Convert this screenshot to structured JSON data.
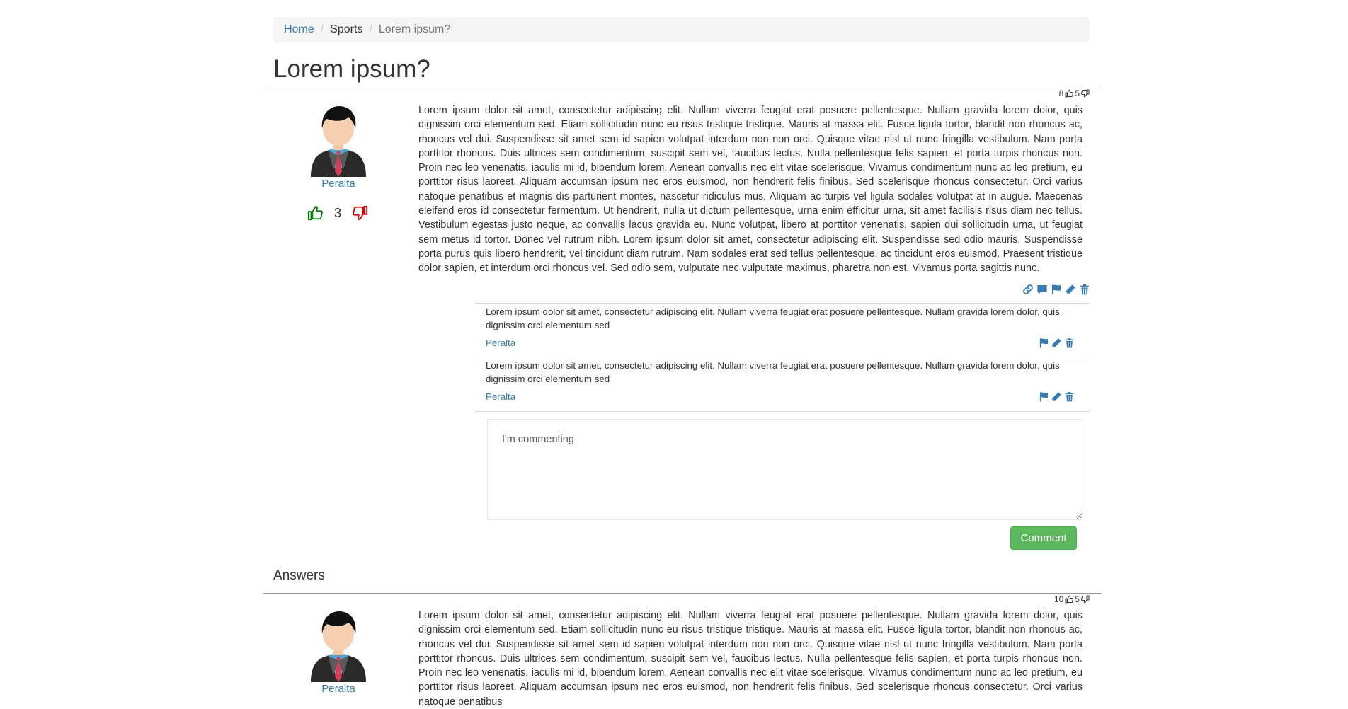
{
  "breadcrumb": {
    "home": "Home",
    "category": "Sports",
    "current": "Lorem ipsum?"
  },
  "question": {
    "title": "Lorem ipsum?",
    "upvotes": "8",
    "downvotes": "5",
    "author": "Peralta",
    "score": "3",
    "body": "Lorem ipsum dolor sit amet, consectetur adipiscing elit. Nullam viverra feugiat erat posuere pellentesque. Nullam gravida lorem dolor, quis dignissim orci elementum sed. Etiam sollicitudin nunc eu risus tristique tristique. Mauris at massa elit. Fusce ligula tortor, blandit non rhoncus ac, rhoncus vel dui. Suspendisse sit amet sem id sapien volutpat interdum non non orci. Quisque vitae nisl ut nunc fringilla vestibulum. Nam porta porttitor rhoncus. Duis ultrices sem condimentum, suscipit sem vel, faucibus lectus. Nulla pellentesque felis sapien, et porta turpis rhoncus non. Proin nec leo venenatis, iaculis mi id, bibendum lorem. Aenean convallis nec elit vitae scelerisque. Vivamus condimentum nunc ac leo pretium, eu porttitor risus laoreet. Aliquam accumsan ipsum nec eros euismod, non hendrerit felis finibus. Sed scelerisque rhoncus consectetur. Orci varius natoque penatibus et magnis dis parturient montes, nascetur ridiculus mus. Aliquam ac turpis vel ligula sodales volutpat at in augue. Maecenas eleifend eros id consectetur fermentum. Ut hendrerit, nulla ut dictum pellentesque, urna enim efficitur urna, sit amet facilisis risus diam nec tellus. Vestibulum egestas justo neque, ac convallis lacus gravida eu. Nunc volutpat, libero at porttitor venenatis, sapien dui sollicitudin urna, ut feugiat sem metus id tortor. Donec vel rutrum nibh. Lorem ipsum dolor sit amet, consectetur adipiscing elit. Suspendisse sed odio mauris. Suspendisse porta purus quis libero hendrerit, vel tincidunt diam rutrum. Nam sodales erat sed tellus pellentesque, ac tincidunt eros euismod. Praesent tristique dolor sapien, et interdum orci rhoncus vel. Sed odio sem, vulputate nec vulputate maximus, pharetra non est. Vivamus porta sagittis nunc."
  },
  "comments": [
    {
      "text": "Lorem ipsum dolor sit amet, consectetur adipiscing elit. Nullam viverra feugiat erat posuere pellentesque. Nullam gravida lorem dolor, quis dignissim orci elementum sed",
      "author": "Peralta"
    },
    {
      "text": "Lorem ipsum dolor sit amet, consectetur adipiscing elit. Nullam viverra feugiat erat posuere pellentesque. Nullam gravida lorem dolor, quis dignissim orci elementum sed",
      "author": "Peralta"
    }
  ],
  "comment_form": {
    "value": "I'm commenting",
    "button_label": "Comment"
  },
  "answers": {
    "heading": "Answers",
    "items": [
      {
        "upvotes": "10",
        "downvotes": "5",
        "author": "Peralta",
        "body": "Lorem ipsum dolor sit amet, consectetur adipiscing elit. Nullam viverra feugiat erat posuere pellentesque. Nullam gravida lorem dolor, quis dignissim orci elementum sed. Etiam sollicitudin nunc eu risus tristique tristique. Mauris at massa elit. Fusce ligula tortor, blandit non rhoncus ac, rhoncus vel dui. Suspendisse sit amet sem id sapien volutpat interdum non non orci. Quisque vitae nisl ut nunc fringilla vestibulum. Nam porta porttitor rhoncus. Duis ultrices sem condimentum, suscipit sem vel, faucibus lectus. Nulla pellentesque felis sapien, et porta turpis rhoncus non. Proin nec leo venenatis, iaculis mi id, bibendum lorem. Aenean convallis nec elit vitae scelerisque. Vivamus condimentum nunc ac leo pretium, eu porttitor risus laoreet. Aliquam accumsan ipsum nec eros euismod, non hendrerit felis finibus. Sed scelerisque rhoncus consectetur. Orci varius natoque penatibus"
      }
    ]
  },
  "colors": {
    "link": "#337ab7",
    "upvote": "#008000",
    "downvote": "#e00000",
    "button": "#5cb85c"
  },
  "icons": [
    "thumbs-up-icon",
    "thumbs-down-icon",
    "link-icon",
    "comment-icon",
    "flag-icon",
    "pencil-icon",
    "trash-icon",
    "avatar-icon"
  ]
}
